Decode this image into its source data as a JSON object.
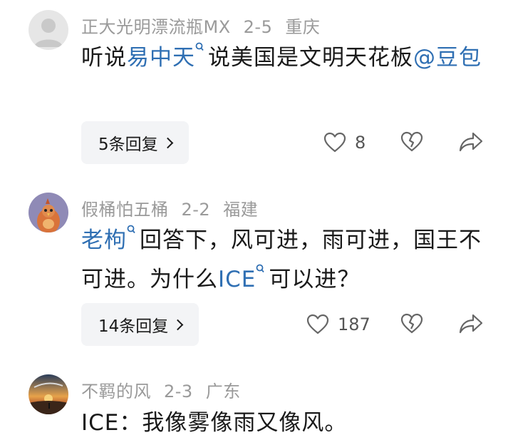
{
  "comments": [
    {
      "user": "正大光明漂流瓶MX",
      "date": "2-5",
      "location": "重庆",
      "text": {
        "p1": "听说",
        "link1": "易中天",
        "p2": "说美国是文明天花板",
        "mention": "@豆包"
      },
      "replies": "5条回复",
      "likes": "8"
    },
    {
      "user": "假桶怕五桶",
      "date": "2-2",
      "location": "福建",
      "text": {
        "link1": "老枸",
        "p1": "回答下，风可进，雨可进，国王不可进。为什么",
        "link2": "ICE",
        "p2": "可以进？"
      },
      "replies": "14条回复",
      "likes": "187"
    },
    {
      "user": "不羁的风",
      "date": "2-3",
      "location": "广东",
      "text": {
        "p1": "ICE：我像雾像雨又像风。"
      }
    }
  ]
}
